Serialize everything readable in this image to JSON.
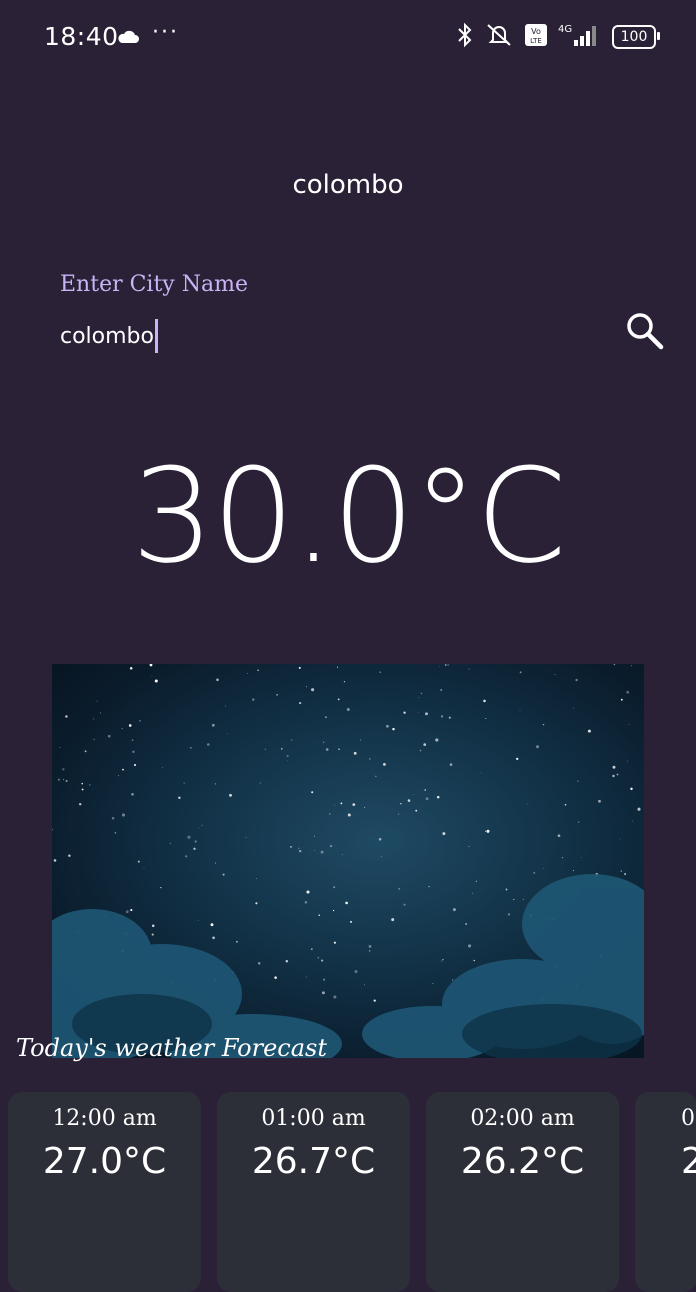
{
  "status": {
    "time": "18:40",
    "dots": "···",
    "network": "4G",
    "volte": "Vo LTE",
    "battery": "100"
  },
  "header": {
    "city_title": "colombo"
  },
  "search": {
    "label": "Enter City Name",
    "value": "colombo"
  },
  "current": {
    "temperature": "30.0°C"
  },
  "forecast": {
    "title": "Today's weather Forecast",
    "items": [
      {
        "time": "12:00 am",
        "temp": "27.0°C"
      },
      {
        "time": "01:00 am",
        "temp": "26.7°C"
      },
      {
        "time": "02:00 am",
        "temp": "26.2°C"
      },
      {
        "time": "0",
        "temp": "2"
      }
    ]
  },
  "colors": {
    "background": "#2a2137",
    "accent": "#c9b4f5",
    "card": "#2d2f38"
  }
}
